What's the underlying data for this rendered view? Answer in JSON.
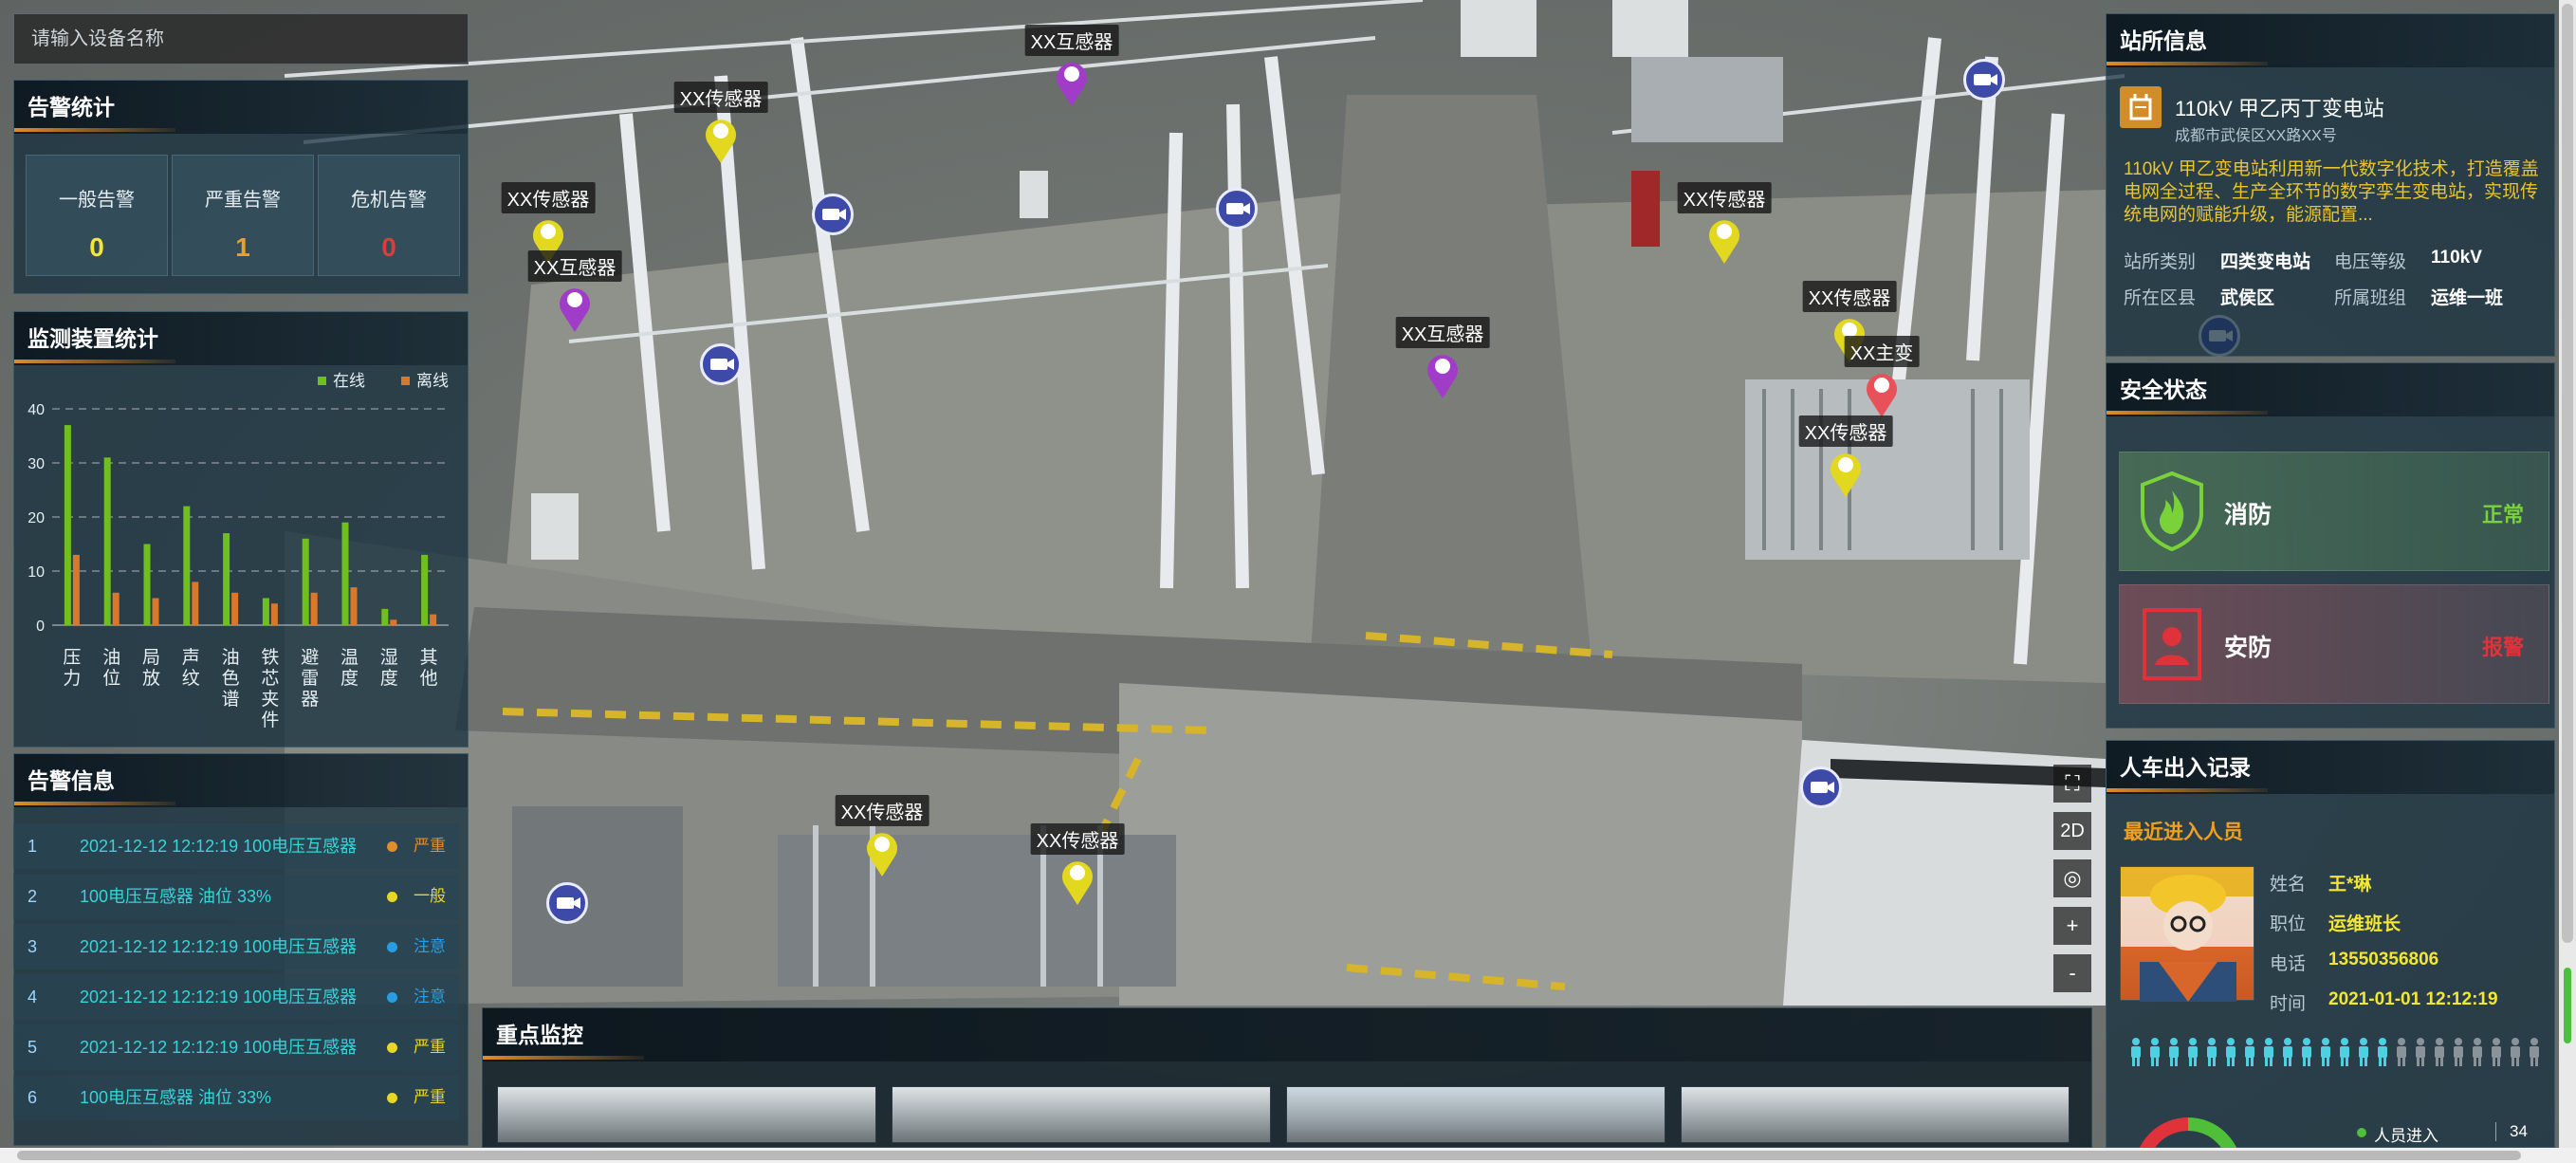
{
  "search": {
    "placeholder": "请输入设备名称"
  },
  "alarm_stats": {
    "title": "告警统计",
    "items": [
      {
        "label": "一般告警",
        "value": "0",
        "color": "#f3e634"
      },
      {
        "label": "严重告警",
        "value": "1",
        "color": "#f0a020"
      },
      {
        "label": "危机告警",
        "value": "0",
        "color": "#e03a3a"
      }
    ]
  },
  "device_stats": {
    "title": "监测装置统计",
    "legend": {
      "online": "在线",
      "offline": "离线"
    }
  },
  "chart_data": {
    "type": "bar",
    "categories": [
      "压力",
      "油位",
      "局放",
      "声纹",
      "油色谱",
      "铁芯夹件",
      "避雷器",
      "温度",
      "湿度",
      "其他"
    ],
    "series": [
      {
        "name": "在线",
        "values": [
          37,
          31,
          15,
          22,
          17,
          5,
          16,
          19,
          3,
          13
        ],
        "color": "#6fbf1f"
      },
      {
        "name": "离线",
        "values": [
          13,
          6,
          5,
          8,
          6,
          4,
          6,
          7,
          1,
          2
        ],
        "color": "#d9772a"
      }
    ],
    "ylim": [
      0,
      40
    ],
    "yticks": [
      0,
      10,
      20,
      30,
      40
    ],
    "grid": true,
    "legend_position": "top-right"
  },
  "alarm_info": {
    "title": "告警信息",
    "rows": [
      {
        "no": "1",
        "msg": "2021-12-12 12:12:19 100电压互感器",
        "level": "严重",
        "dot": "#e08d2a"
      },
      {
        "no": "2",
        "msg": "100电压互感器 油位 33%",
        "level": "一般",
        "dot": "#e8d52a"
      },
      {
        "no": "3",
        "msg": "2021-12-12 12:12:19 100电压互感器",
        "level": "注意",
        "dot": "#2a9de0"
      },
      {
        "no": "4",
        "msg": "2021-12-12 12:12:19 100电压互感器",
        "level": "注意",
        "dot": "#2a9de0"
      },
      {
        "no": "5",
        "msg": "2021-12-12 12:12:19 100电压互感器",
        "level": "严重",
        "dot": "#e8d52a"
      },
      {
        "no": "6",
        "msg": "100电压互感器 油位 33%",
        "level": "严重",
        "dot": "#e8d52a"
      }
    ]
  },
  "markers": [
    {
      "label": "XX互感器",
      "color": "#a13cc8"
    },
    {
      "label": "XX传感器",
      "color": "#e2d820"
    },
    {
      "label": "XX传感器",
      "color": "#e2d820"
    },
    {
      "label": "XX互感器",
      "color": "#a13cc8"
    },
    {
      "label": "XX互感器",
      "color": "#a13cc8"
    },
    {
      "label": "XX传感器",
      "color": "#e2d820"
    },
    {
      "label": "XX传感器",
      "color": "#e2d820"
    },
    {
      "label": "XX主变",
      "color": "#e8505a"
    },
    {
      "label": "XX传感器",
      "color": "#e2d820"
    },
    {
      "label": "XX传感器",
      "color": "#e2d820"
    },
    {
      "label": "XX传感器",
      "color": "#e2d820"
    }
  ],
  "map_controls": {
    "fullscreen": "⛶",
    "mode": "2D",
    "locate": "◎",
    "zoom_in": "+",
    "zoom_out": "-"
  },
  "key_monitor": {
    "title": "重点监控"
  },
  "station": {
    "title": "站所信息",
    "name": "110kV 甲乙丙丁变电站",
    "address": "成都市武侯区XX路XX号",
    "desc": "110kV 甲乙变电站利用新一代数字化技术，打造覆盖电网全过程、生产全环节的数字孪生变电站，实现传统电网的赋能升级，能源配置...",
    "type_label": "站所类别",
    "type_value": "四类变电站",
    "voltage_label": "电压等级",
    "voltage_value": "110kV",
    "district_label": "所在区县",
    "district_value": "武侯区",
    "team_label": "所属班组",
    "team_value": "运维一班"
  },
  "safety": {
    "title": "安全状态",
    "fire": {
      "label": "消防",
      "status": "正常",
      "color": "#7ad23a"
    },
    "security": {
      "label": "安防",
      "status": "报警",
      "color": "#e0323a"
    }
  },
  "access": {
    "title": "人车出入记录",
    "subtitle": "最近进入人员",
    "name_label": "姓名",
    "name_value": "王*琳",
    "role_label": "职位",
    "role_value": "运维班长",
    "phone_label": "电话",
    "phone_value": "13550356806",
    "time_label": "时间",
    "time_value": "2021-01-01 12:12:19",
    "people_total": 22,
    "people_active": 14,
    "entry_label": "人员进入",
    "entry_value": "34"
  }
}
